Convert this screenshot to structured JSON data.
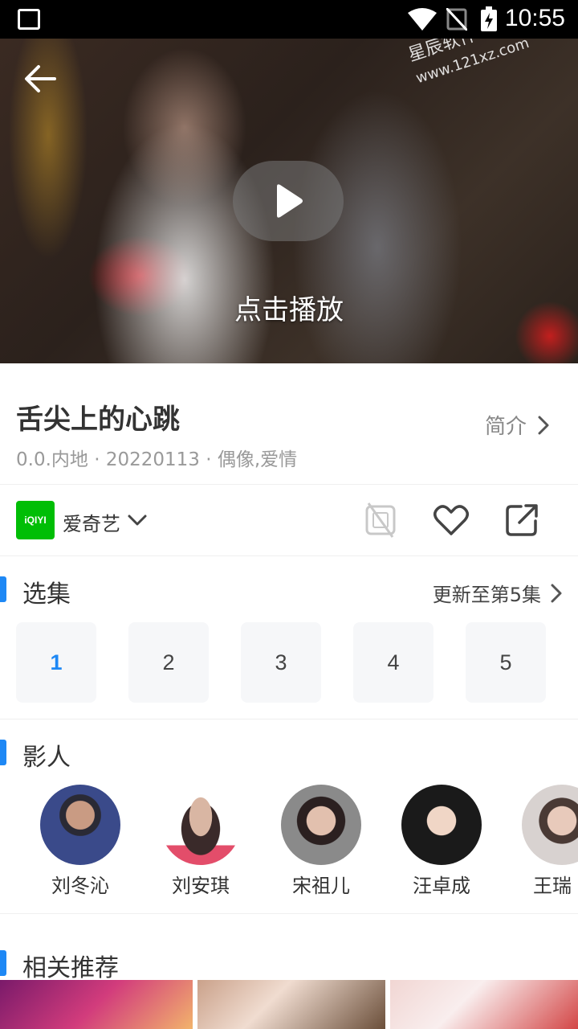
{
  "status_bar": {
    "time": "10:55"
  },
  "video": {
    "play_label": "点击播放",
    "watermark_line1": "星辰软件站",
    "watermark_line2": "www.121xz.com"
  },
  "show": {
    "title": "舌尖上的心跳",
    "meta": "0.0.内地 · 20220113 · 偶像,爱情",
    "intro_label": "简介"
  },
  "source": {
    "name": "爱奇艺",
    "logo_text": "iQIYI"
  },
  "episodes": {
    "section_title": "选集",
    "update_label": "更新至第5集",
    "items": [
      "1",
      "2",
      "3",
      "4",
      "5"
    ],
    "selected": "1"
  },
  "cast": {
    "section_title": "影人",
    "people": [
      "刘冬沁",
      "刘安琪",
      "宋祖儿",
      "汪卓成",
      "王瑞"
    ]
  },
  "recommend": {
    "section_title": "相关推荐"
  },
  "colors": {
    "accent": "#1e88f5",
    "source_logo": "#00be06"
  }
}
